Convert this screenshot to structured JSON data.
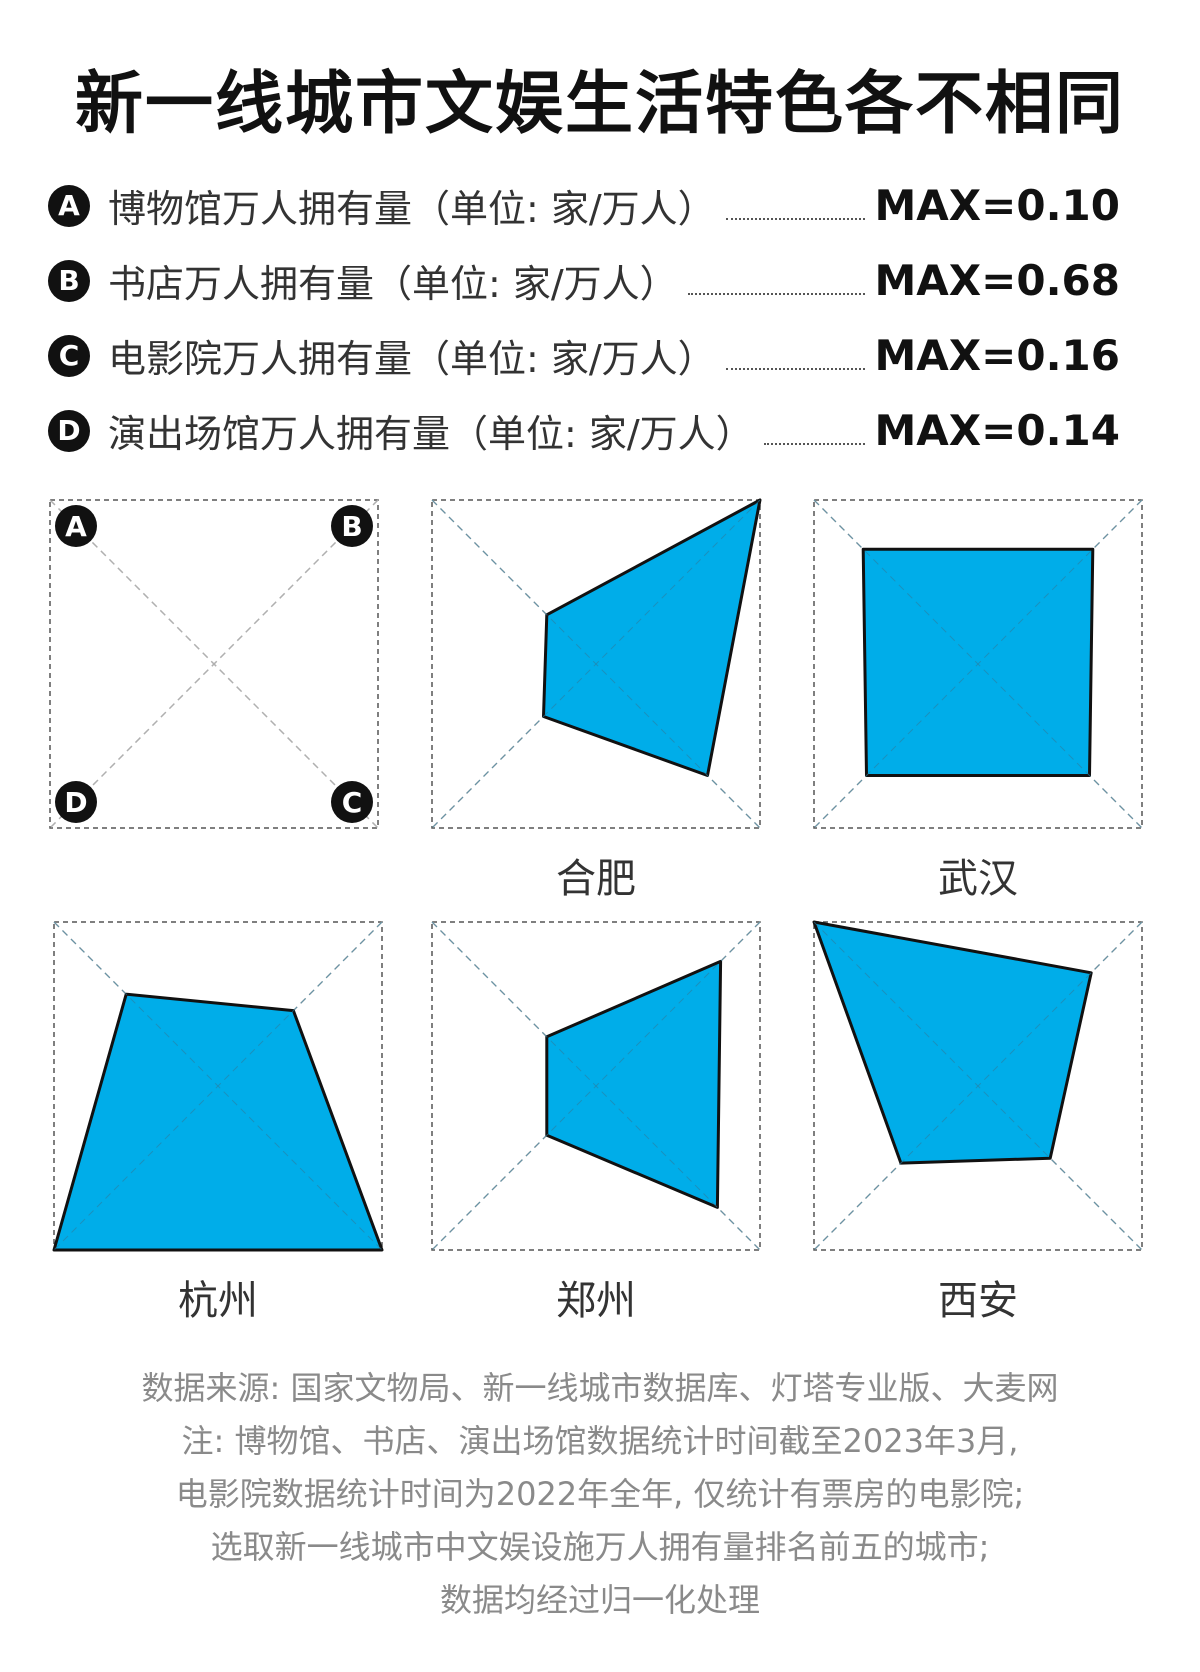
{
  "title": "新一线城市文娱生活特色各不相同",
  "legend": [
    {
      "key": "A",
      "label": "博物馆万人拥有量（单位: 家/万人）",
      "max_label": "MAX=0.10"
    },
    {
      "key": "B",
      "label": "书店万人拥有量（单位: 家/万人）",
      "max_label": "MAX=0.68"
    },
    {
      "key": "C",
      "label": "电影院万人拥有量（单位: 家/万人）",
      "max_label": "MAX=0.16"
    },
    {
      "key": "D",
      "label": "演出场馆万人拥有量（单位: 家/万人）",
      "max_label": "MAX=0.14"
    }
  ],
  "chart_data": {
    "type": "radar",
    "axes": [
      "A",
      "B",
      "C",
      "D"
    ],
    "axis_placement": {
      "A": "top-left",
      "B": "top-right",
      "C": "bottom-right",
      "D": "bottom-left"
    },
    "normalized": true,
    "range": [
      0,
      1
    ],
    "series": [
      {
        "name": "合肥",
        "values": [
          0.3,
          1.0,
          0.68,
          0.32
        ]
      },
      {
        "name": "武汉",
        "values": [
          0.7,
          0.7,
          0.68,
          0.68
        ]
      },
      {
        "name": "杭州",
        "values": [
          0.56,
          0.46,
          1.0,
          1.0
        ]
      },
      {
        "name": "郑州",
        "values": [
          0.3,
          0.76,
          0.74,
          0.3
        ]
      },
      {
        "name": "西安",
        "values": [
          1.0,
          0.69,
          0.44,
          0.47
        ]
      }
    ],
    "colors": {
      "fill": "#00ADE9",
      "stroke": "#111111",
      "frame": "#555555",
      "diagonal": "#b0b0b0"
    }
  },
  "notes": [
    "数据来源: 国家文物局、新一线城市数据库、灯塔专业版、大麦网",
    "注: 博物馆、书店、演出场馆数据统计时间截至2023年3月,",
    "电影院数据统计时间为2022年全年, 仅统计有票房的电影院;",
    "选取新一线城市中文娱设施万人拥有量排名前五的城市;",
    "数据均经过归一化处理"
  ]
}
